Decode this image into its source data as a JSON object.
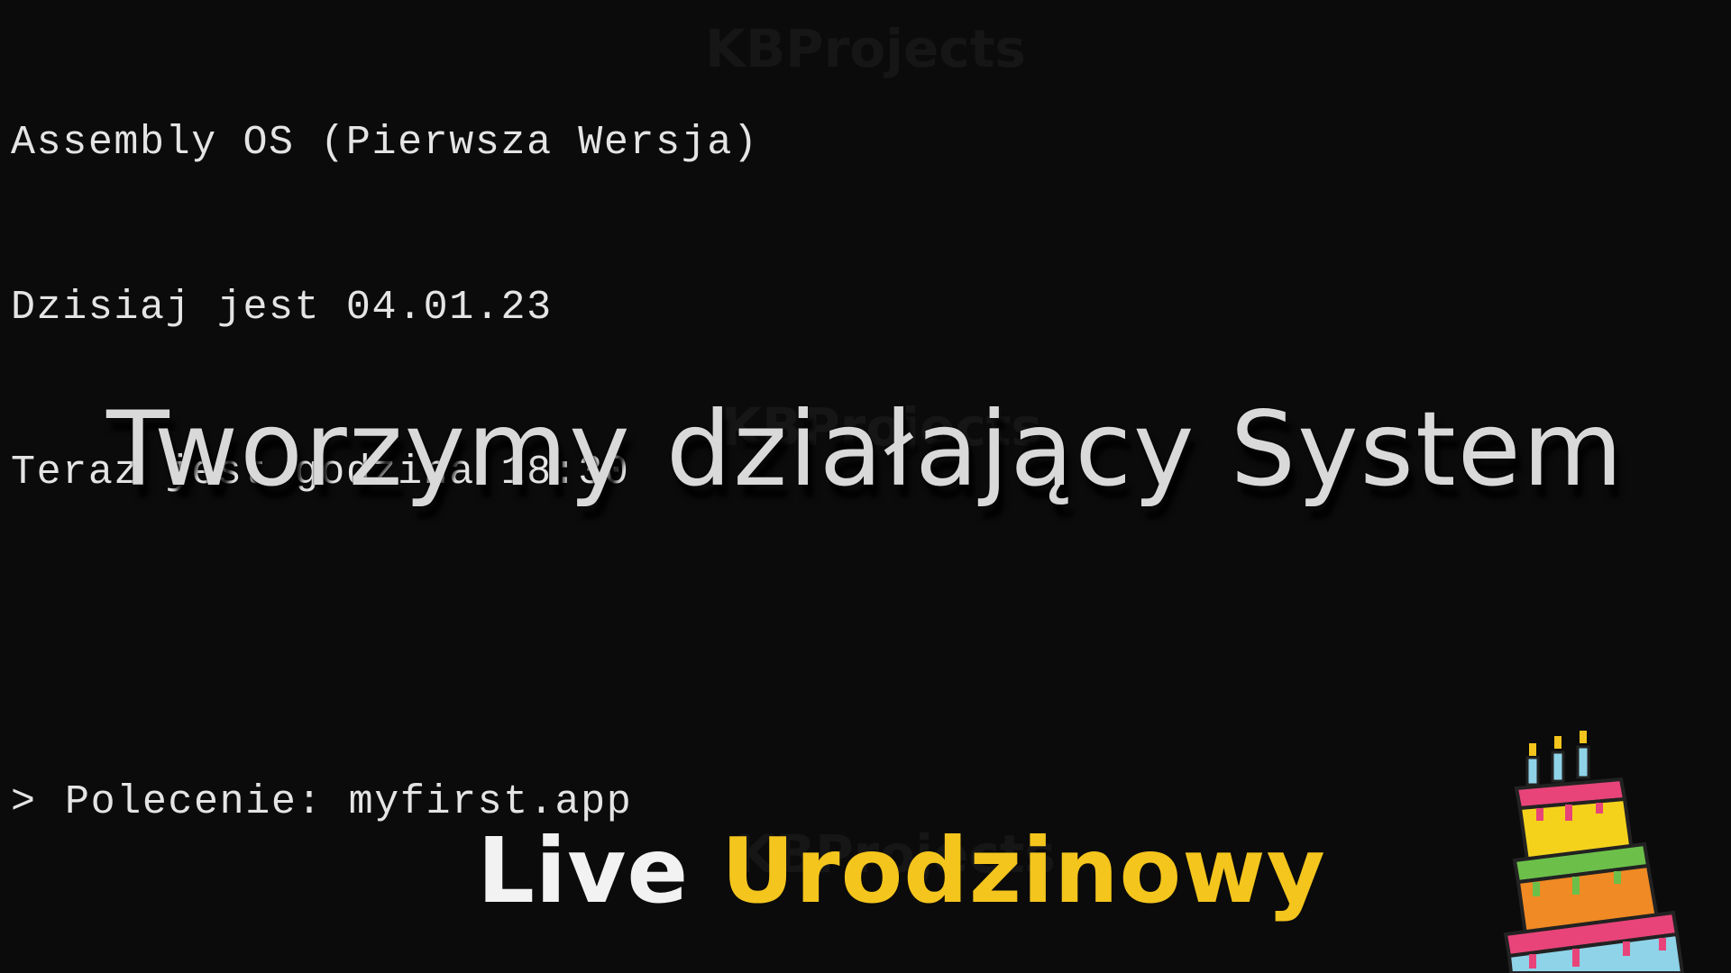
{
  "terminal": {
    "lines": [
      "Assembly OS (Pierwsza Wersja)",
      "Dzisiaj jest 04.01.23",
      "Teraz jest godzina 18:30"
    ],
    "prompt_symbol": ">",
    "command": "Polecenie: myfirst.app"
  },
  "watermark": "KBProjects",
  "headline": "Tworzymy działający System",
  "live": {
    "word": "Live",
    "accent_word": "Urodzinowy"
  },
  "colors": {
    "background": "#0b0b0b",
    "text": "#e4e4e4",
    "accent": "#f4c51c"
  },
  "decoration": {
    "icon": "birthday-cake-icon"
  }
}
